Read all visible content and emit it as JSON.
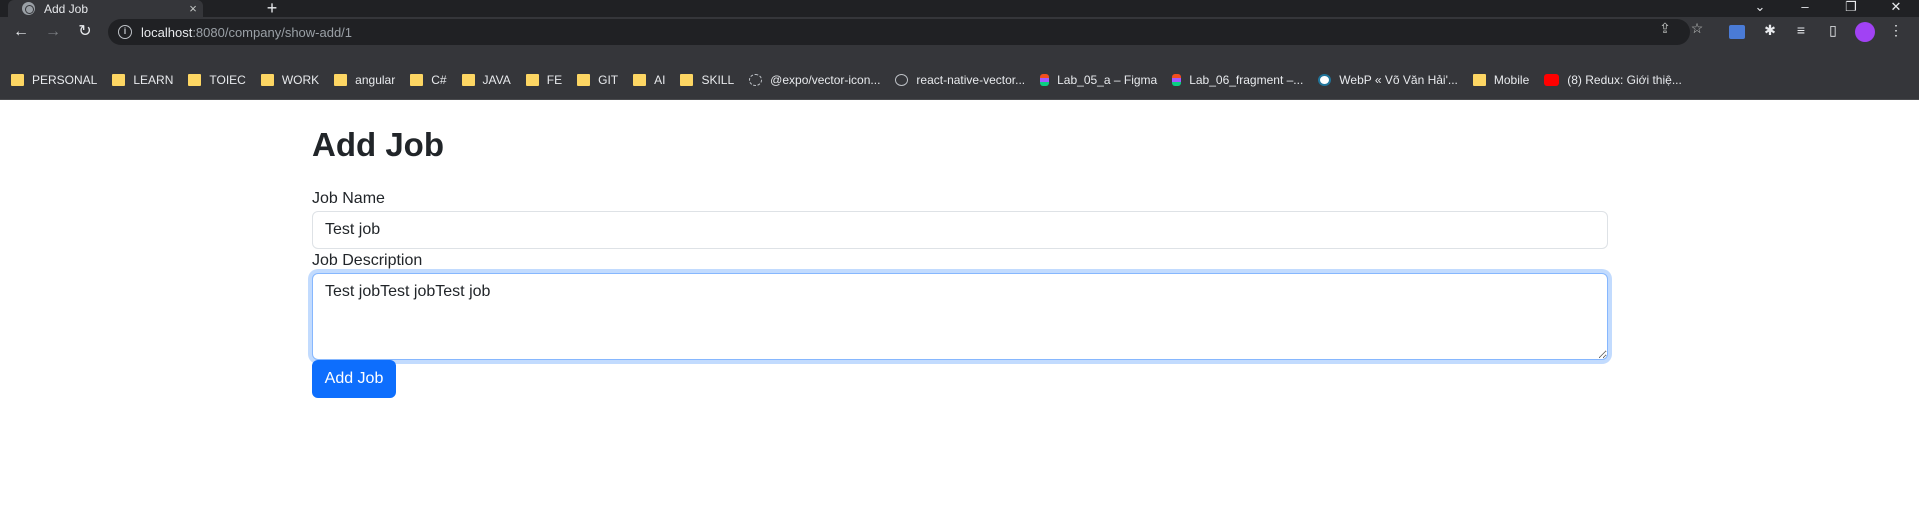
{
  "browser": {
    "tab": {
      "title": "Add Job",
      "close_icon": "×"
    },
    "new_tab_icon": "+",
    "window_controls": {
      "menu": "⌄",
      "minimize": "–",
      "restore": "❐",
      "close": "✕"
    },
    "nav": {
      "back": "←",
      "forward": "→",
      "reload": "↻"
    },
    "omnibox": {
      "host": "localhost",
      "path": ":8080/company/show-add/1"
    },
    "toolbar_icons": {
      "share": "⇪",
      "star": "☆",
      "extensions": "✱",
      "media": "≡",
      "side_panel": "▯",
      "menu": "⋮"
    }
  },
  "bookmarks": [
    {
      "icon": "folder",
      "label": "PERSONAL"
    },
    {
      "icon": "folder",
      "label": "LEARN"
    },
    {
      "icon": "folder",
      "label": "TOIEC"
    },
    {
      "icon": "folder",
      "label": "WORK"
    },
    {
      "icon": "folder",
      "label": "angular"
    },
    {
      "icon": "folder",
      "label": "C#"
    },
    {
      "icon": "folder",
      "label": "JAVA"
    },
    {
      "icon": "folder",
      "label": "FE"
    },
    {
      "icon": "folder",
      "label": "GIT"
    },
    {
      "icon": "folder",
      "label": "AI"
    },
    {
      "icon": "folder",
      "label": "SKILL"
    },
    {
      "icon": "expo",
      "label": "@expo/vector-icon..."
    },
    {
      "icon": "globe",
      "label": "react-native-vector..."
    },
    {
      "icon": "figma",
      "label": "Lab_05_a – Figma"
    },
    {
      "icon": "figma",
      "label": "Lab_06_fragment –..."
    },
    {
      "icon": "wordpress",
      "label": "WebP « Võ Văn Hải'..."
    },
    {
      "icon": "folder",
      "label": "Mobile"
    },
    {
      "icon": "youtube",
      "label": "(8) Redux: Giới thiệ..."
    }
  ],
  "page": {
    "title": "Add Job",
    "job_name": {
      "label": "Job Name",
      "value": "Test job"
    },
    "job_description": {
      "label": "Job Description",
      "value": "Test jobTest jobTest job"
    },
    "submit_label": "Add Job"
  },
  "colors": {
    "primary": "#0d6efd",
    "focus_border": "#86b7fe",
    "chrome_dark": "#202124",
    "chrome_toolbar": "#35363a"
  }
}
